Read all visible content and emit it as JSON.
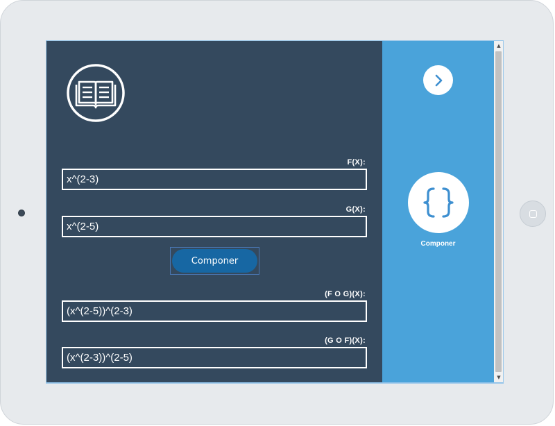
{
  "form": {
    "f_label": "F(X):",
    "f_value": "x^(2-3)",
    "g_label": "G(X):",
    "g_value": "x^(2-5)",
    "compose_button_label": "Componer",
    "fog_label": "(F O G)(X):",
    "fog_value": "(x^(2-5))^(2-3)",
    "gof_label": "(G O F)(X):",
    "gof_value": "(x^(2-3))^(2-5)"
  },
  "sidebar": {
    "compose_icon_label": "Componer",
    "next_icon": "chevron-right-icon",
    "compose_icon": "curly-braces-icon"
  },
  "colors": {
    "left_panel": "#34495e",
    "right_panel": "#4aa3da",
    "button": "#1767a3",
    "accent": "#3d8fd0"
  }
}
